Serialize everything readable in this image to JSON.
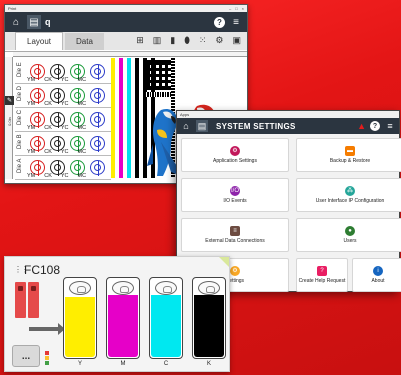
{
  "layout_window": {
    "title": "Print",
    "filename": "q",
    "tabs": [
      {
        "label": "Layout",
        "selected": true
      },
      {
        "label": "Data",
        "selected": false
      }
    ],
    "ruler_label": "0.0in",
    "dies": [
      "Die E",
      "Die D",
      "Die C",
      "Die B",
      "Die A"
    ],
    "codes": [
      "YM",
      "CK",
      "YC",
      "MC"
    ]
  },
  "settings_window": {
    "title": "Apps",
    "header": "SYSTEM SETTINGS",
    "tiles": [
      {
        "label": "Application Settings",
        "icon": "gear-icon",
        "color": "#c2185b"
      },
      {
        "label": "Backup & Restore",
        "icon": "folder-icon",
        "color": "#f57c00"
      },
      {
        "label": "I/O Events",
        "icon": "io-icon",
        "color": "#8e24aa"
      },
      {
        "label": "User Interface IP Configuration",
        "icon": "network-icon",
        "color": "#26a69a"
      },
      {
        "label": "External Data Connections",
        "icon": "database-icon",
        "color": "#6d4c41"
      },
      {
        "label": "Users",
        "icon": "users-icon",
        "color": "#2e7d32"
      },
      {
        "label": "Settings",
        "icon": "settings-icon",
        "color": "#f9a825"
      },
      {
        "label": "Create Help Request",
        "icon": "help-request-icon",
        "color": "#e91e63"
      },
      {
        "label": "About",
        "icon": "info-icon",
        "color": "#1565c0"
      }
    ]
  },
  "ink_window": {
    "printer": "FC108",
    "more_label": "...",
    "inks": [
      {
        "label": "Y",
        "color": "#ffee00",
        "level": 0.75
      },
      {
        "label": "M",
        "color": "#e600c8",
        "level": 0.78
      },
      {
        "label": "C",
        "color": "#00e8f0",
        "level": 0.77
      },
      {
        "label": "K",
        "color": "#000000",
        "level": 0.77
      }
    ]
  }
}
